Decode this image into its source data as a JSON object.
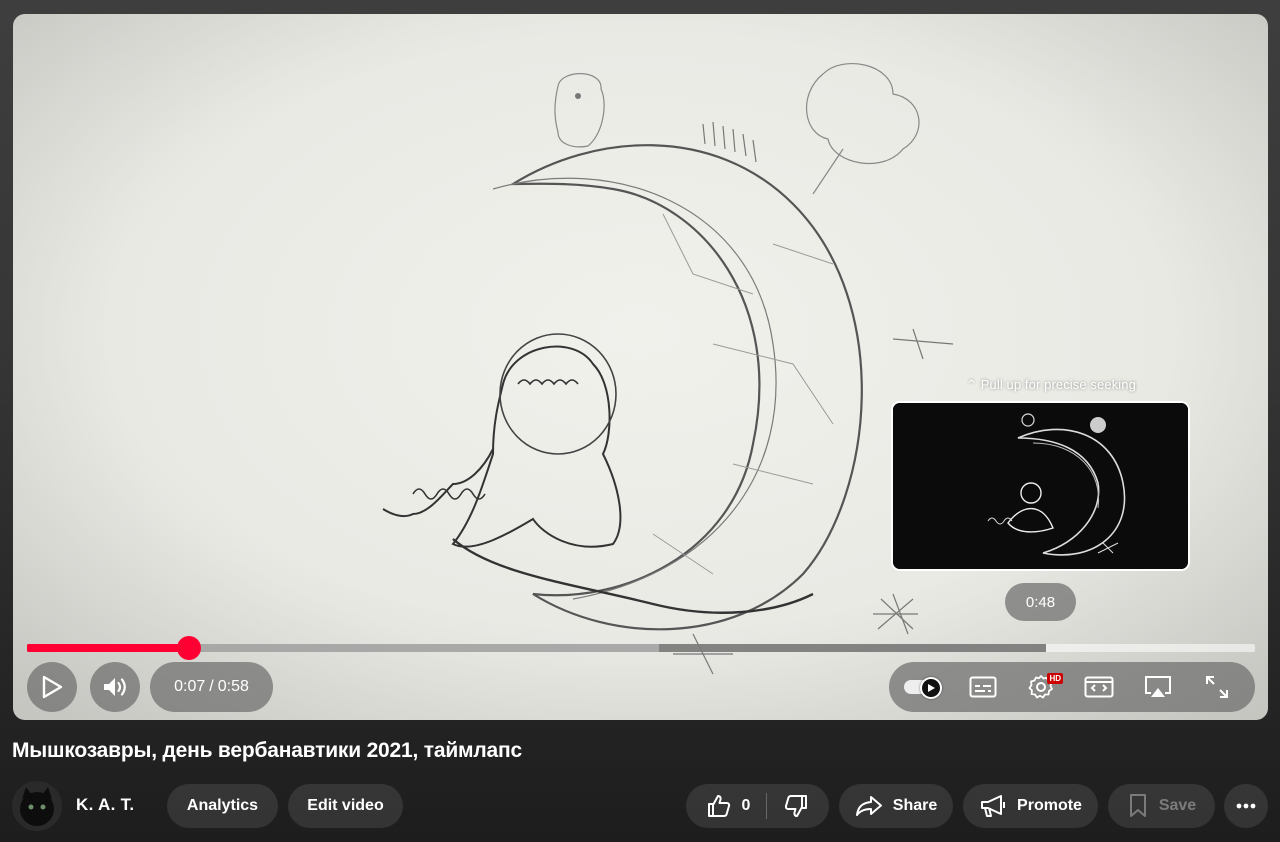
{
  "player": {
    "seek_hint": "Pull up for precise seeking",
    "preview_time": "0:48",
    "current_time": "0:07",
    "time_separator": "/",
    "duration": "0:58",
    "progress": {
      "played_fraction": 0.132,
      "buffered_fraction": 0.515,
      "hover_fraction": 0.83
    },
    "accent_color": "#ff0033",
    "controls": {
      "play": "play-icon",
      "volume": "volume-icon",
      "autoplay": "autoplay-toggle",
      "subtitles": "subtitles-icon",
      "settings": "settings-icon",
      "settings_badge": "HD",
      "miniplayer": "miniplayer-icon",
      "airplay": "airplay-icon",
      "fullscreen": "fullscreen-icon"
    }
  },
  "video": {
    "title": "Мышкозавры, день вербанавтики 2021, таймлапс"
  },
  "channel": {
    "name": "K. A. T."
  },
  "actions": {
    "analytics": "Analytics",
    "edit_video": "Edit video",
    "like_count": "0",
    "share": "Share",
    "promote": "Promote",
    "save": "Save"
  }
}
